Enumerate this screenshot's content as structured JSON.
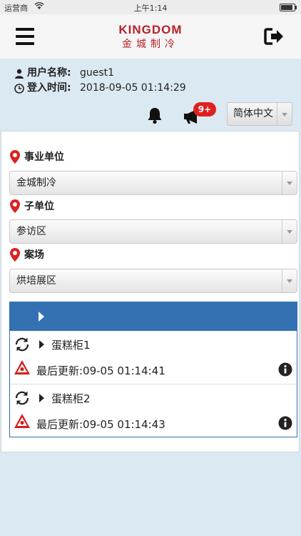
{
  "status_bar": {
    "carrier": "运营商",
    "time": "上午1:14",
    "battery_level": 0.9
  },
  "header": {
    "logo_en": "KINGDOM",
    "logo_cn": "金城制冷"
  },
  "user": {
    "name_label": "用户名称:",
    "name_value": "guest1",
    "login_label": "登入时间:",
    "login_value": "2018-09-05 01:14:29"
  },
  "toolbar": {
    "badge": "9+",
    "language": "简体中文"
  },
  "filters": {
    "unit_label": "事业单位",
    "unit_value": "金城制冷",
    "subunit_label": "子单位",
    "subunit_value": "参访区",
    "site_label": "案场",
    "site_value": "烘培展区"
  },
  "devices": [
    {
      "name": "蛋糕柜1",
      "updated": "最后更新:09-05 01:14:41"
    },
    {
      "name": "蛋糕柜2",
      "updated": "最后更新:09-05 01:14:43"
    }
  ],
  "colors": {
    "accent": "#3471b3",
    "brand": "#b8222a",
    "alert": "#e02020"
  }
}
